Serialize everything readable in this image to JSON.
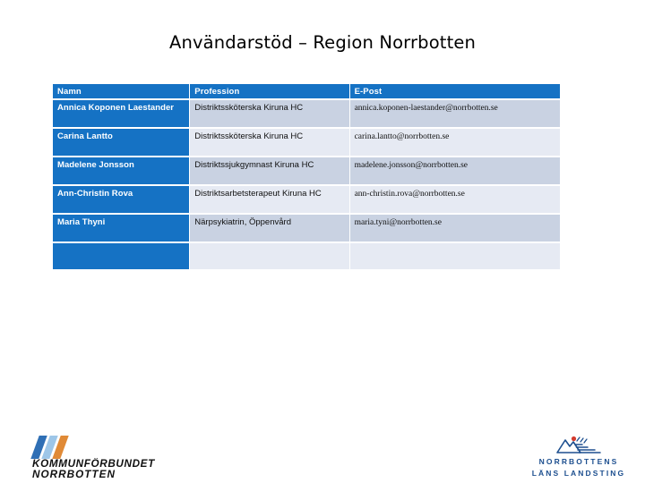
{
  "slide": {
    "title": "Användarstöd – Region Norrbotten"
  },
  "colors": {
    "header_blue": "#1572c4",
    "name_cell_blue": "#1572c4",
    "band_dark": "#c9d2e2",
    "band_light": "#e6eaf3",
    "logo_blue": "#1d4f8f",
    "logo_orange": "#e08a36",
    "logo_lightblue": "#9dc6e8",
    "logo_red": "#d33b2f"
  },
  "table": {
    "headers": [
      "Namn",
      "Profession",
      "E-Post"
    ],
    "rows": [
      {
        "namn": "Annica Koponen Laestander",
        "profession": "Distriktssköterska Kiruna HC",
        "epost": "annica.koponen-laestander@norrbotten.se"
      },
      {
        "namn": "Carina Lantto",
        "profession": "Distriktssköterska Kiruna HC",
        "epost": "carina.lantto@norrbotten.se"
      },
      {
        "namn": "Madelene Jonsson",
        "profession": "Distriktssjukgymnast Kiruna HC",
        "epost": "madelene.jonsson@norrbotten.se"
      },
      {
        "namn": "Ann-Christin Rova",
        "profession": "Distriktsarbetsterapeut Kiruna HC",
        "epost": "ann-christin.rova@norrbotten.se"
      },
      {
        "namn": "Maria Thyni",
        "profession": "Närpsykiatrin, Öppenvård",
        "epost": "maria.tyni@norrbotten.se"
      },
      {
        "namn": "",
        "profession": "",
        "epost": ""
      }
    ]
  },
  "footer": {
    "logo_left": {
      "line1": "KOMMUNFÖRBUNDET",
      "line2": "NORRBOTTEN",
      "icon": "three-slanted-bars-icon"
    },
    "logo_right": {
      "line1": "NORRBOTTENS",
      "line2": "LÄNS LANDSTING",
      "icon": "mountain-sun-emblem-icon"
    }
  }
}
